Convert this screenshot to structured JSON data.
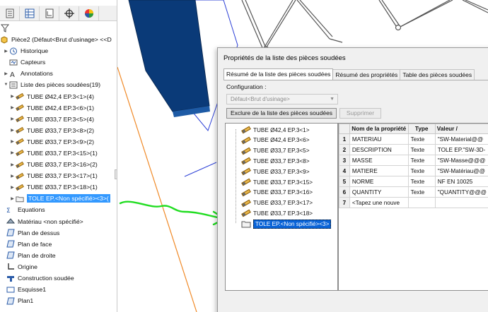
{
  "tree": {
    "root_label": "Pièce2 (Défaut<Brut d'usinage> <<D",
    "items": [
      {
        "label": "Historique",
        "icon": "history-icon",
        "indent": 1,
        "expander": "▶"
      },
      {
        "label": "Capteurs",
        "icon": "sensors-icon",
        "indent": 1,
        "expander": ""
      },
      {
        "label": "Annotations",
        "icon": "annotations-icon",
        "indent": 1,
        "expander": "▶"
      },
      {
        "label": "Liste des pièces soudées(19)",
        "icon": "cut-list-icon",
        "indent": 1,
        "expander": "▼"
      },
      {
        "label": "TUBE Ø42,4 EP.3<1>(4)",
        "icon": "weldment-body-icon",
        "indent": 2,
        "expander": "▶"
      },
      {
        "label": "TUBE Ø42,4 EP.3<6>(1)",
        "icon": "weldment-body-icon",
        "indent": 2,
        "expander": "▶"
      },
      {
        "label": "TUBE Ø33,7 EP.3<5>(4)",
        "icon": "weldment-body-icon",
        "indent": 2,
        "expander": "▶"
      },
      {
        "label": "TUBE Ø33,7 EP.3<8>(2)",
        "icon": "weldment-body-icon",
        "indent": 2,
        "expander": "▶"
      },
      {
        "label": "TUBE Ø33,7 EP.3<9>(2)",
        "icon": "weldment-body-icon",
        "indent": 2,
        "expander": "▶"
      },
      {
        "label": "TUBE Ø33,7 EP.3<15>(1)",
        "icon": "weldment-body-icon",
        "indent": 2,
        "expander": "▶"
      },
      {
        "label": "TUBE Ø33,7 EP.3<16>(2)",
        "icon": "weldment-body-icon",
        "indent": 2,
        "expander": "▶"
      },
      {
        "label": "TUBE Ø33,7 EP.3<17>(1)",
        "icon": "weldment-body-icon",
        "indent": 2,
        "expander": "▶"
      },
      {
        "label": "TUBE Ø33,7 EP.3<18>(1)",
        "icon": "weldment-body-icon",
        "indent": 2,
        "expander": "▶"
      },
      {
        "label": "TOLE EP.<Non spécifié><3>(",
        "icon": "sheet-folder-icon",
        "indent": 2,
        "expander": "▶",
        "selected": true
      },
      {
        "label": "Equations",
        "icon": "equations-icon",
        "indent": 0,
        "expander": ""
      },
      {
        "label": "Matériau <non spécifié>",
        "icon": "material-icon",
        "indent": 0,
        "expander": ""
      },
      {
        "label": "Plan de dessus",
        "icon": "plane-icon",
        "indent": 0,
        "expander": ""
      },
      {
        "label": "Plan de face",
        "icon": "plane-icon",
        "indent": 0,
        "expander": ""
      },
      {
        "label": "Plan de droite",
        "icon": "plane-icon",
        "indent": 0,
        "expander": ""
      },
      {
        "label": "Origine",
        "icon": "origin-icon",
        "indent": 0,
        "expander": ""
      },
      {
        "label": "Construction soudée",
        "icon": "weldment-icon",
        "indent": 0,
        "expander": ""
      },
      {
        "label": "Esquisse1",
        "icon": "sketch-icon",
        "indent": 0,
        "expander": ""
      },
      {
        "label": "Plan1",
        "icon": "plane-icon",
        "indent": 0,
        "expander": ""
      }
    ]
  },
  "dialog": {
    "title": "Propriétés de la liste des pièces soudées",
    "tabs": [
      "Résumé de la liste des pièces soudées",
      "Résumé des propriétés",
      "Table des pièces soudées"
    ],
    "config_label": "Configuration :",
    "config_value": "Défaut<Brut d'usinage>",
    "exclude_button": "Exclure de la liste des pièces soudées",
    "delete_button": "Supprimer",
    "cut_list": [
      {
        "label": "TUBE Ø42,4 EP.3<1>",
        "icon": "weldment-body-icon"
      },
      {
        "label": "TUBE Ø42,4 EP.3<6>",
        "icon": "weldment-body-icon"
      },
      {
        "label": "TUBE Ø33,7 EP.3<5>",
        "icon": "weldment-body-icon"
      },
      {
        "label": "TUBE Ø33,7 EP.3<8>",
        "icon": "weldment-body-icon"
      },
      {
        "label": "TUBE Ø33,7 EP.3<9>",
        "icon": "weldment-body-icon"
      },
      {
        "label": "TUBE Ø33,7 EP.3<15>",
        "icon": "weldment-body-icon"
      },
      {
        "label": "TUBE Ø33,7 EP.3<16>",
        "icon": "weldment-body-icon"
      },
      {
        "label": "TUBE Ø33,7 EP.3<17>",
        "icon": "weldment-body-icon"
      },
      {
        "label": "TUBE Ø33,7 EP.3<18>",
        "icon": "weldment-body-icon"
      },
      {
        "label": "TOLE EP.<Non spécifié><3>",
        "icon": "sheet-folder-icon",
        "selected": true
      }
    ],
    "grid": {
      "headers": [
        "",
        "Nom de la propriété",
        "Type",
        "Valeur /"
      ],
      "rows": [
        [
          "1",
          "MATERIAU",
          "Texte",
          "\"SW-Material@@"
        ],
        [
          "2",
          "DESCRIPTION",
          "Texte",
          "TOLE EP.\"SW-3D-"
        ],
        [
          "3",
          "MASSE",
          "Texte",
          "\"SW-Masse@@@"
        ],
        [
          "4",
          "MATIERE",
          "Texte",
          "\"SW-Matériau@@"
        ],
        [
          "5",
          "NORME",
          "Texte",
          "NF EN 10025"
        ],
        [
          "6",
          "QUANTITY",
          "Texte",
          "\"QUANTITY@@@"
        ],
        [
          "7",
          "<Tapez une nouve",
          "",
          ""
        ]
      ]
    }
  },
  "colors": {
    "selection": "#3399ff",
    "dialog_selection": "#0a64d8",
    "model_blue": "#0a3a78",
    "orange_line": "#f08a28",
    "annotation_green": "#22dd22"
  }
}
